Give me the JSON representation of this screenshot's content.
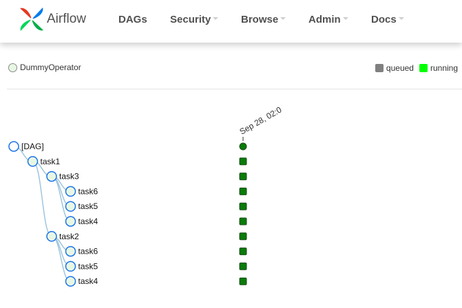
{
  "brand": {
    "name": "Airflow"
  },
  "nav": [
    {
      "label": "DAGs",
      "dropdown": false
    },
    {
      "label": "Security",
      "dropdown": true
    },
    {
      "label": "Browse",
      "dropdown": true
    },
    {
      "label": "Admin",
      "dropdown": true
    },
    {
      "label": "Docs",
      "dropdown": true
    }
  ],
  "legend": {
    "operators": [
      {
        "label": "DummyOperator",
        "color": "#e8f7e4"
      }
    ],
    "states": [
      {
        "label": "queued",
        "color": "#808080"
      },
      {
        "label": "running",
        "color": "#00ff00"
      }
    ]
  },
  "run_header": "Sep 28, 02:0",
  "tree": {
    "dag_label": "[DAG]",
    "node_fill": "#e8f7e4",
    "node_stroke": "#1a73e8",
    "link_color": "#9ec5de",
    "status_fill": "#0a7a0a",
    "status_stroke": "#1e4d1e",
    "nodes": [
      {
        "id": "dag",
        "label": "[DAG]",
        "depth": 0,
        "parent": null
      },
      {
        "id": "t1",
        "label": "task1",
        "depth": 1,
        "parent": "dag"
      },
      {
        "id": "t1_t3",
        "label": "task3",
        "depth": 2,
        "parent": "t1"
      },
      {
        "id": "t1_t3_t6",
        "label": "task6",
        "depth": 3,
        "parent": "t1_t3"
      },
      {
        "id": "t1_t3_t5",
        "label": "task5",
        "depth": 3,
        "parent": "t1_t3"
      },
      {
        "id": "t1_t3_t4",
        "label": "task4",
        "depth": 3,
        "parent": "t1_t3"
      },
      {
        "id": "t1_t2",
        "label": "task2",
        "depth": 2,
        "parent": "t1"
      },
      {
        "id": "t1_t2_t6",
        "label": "task6",
        "depth": 3,
        "parent": "t1_t2"
      },
      {
        "id": "t1_t2_t5",
        "label": "task5",
        "depth": 3,
        "parent": "t1_t2"
      },
      {
        "id": "t1_t2_t4",
        "label": "task4",
        "depth": 3,
        "parent": "t1_t2"
      }
    ]
  }
}
